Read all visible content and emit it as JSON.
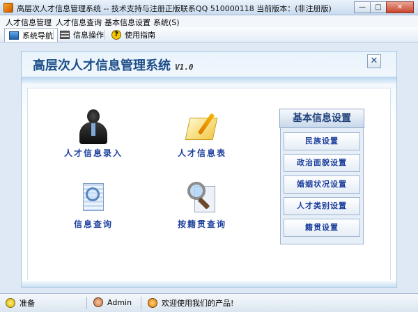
{
  "window": {
    "title": "高层次人才信息管理系统 -- 技术支持与注册正版联系QQ 510000118    当前版本：(非注册版)",
    "min_label": "—",
    "max_label": "□",
    "close_label": "✕"
  },
  "menu": [
    "人才信息管理",
    "人才信息查询",
    "基本信息设置",
    "系统(S)"
  ],
  "toolbar": {
    "nav_label": "系统导航",
    "info_label": "信息操作",
    "help_label": "使用指南",
    "help_glyph": "?"
  },
  "panel": {
    "title": "高层次人才信息管理系统",
    "version": "V1.0",
    "close_glyph": "✕"
  },
  "modules": {
    "entry": "人才信息录入",
    "table": "人才信息表",
    "query": "信息查询",
    "native_query": "按籍贯查询"
  },
  "settings": {
    "title": "基本信息设置",
    "items": [
      "民族设置",
      "政治面貌设置",
      "婚姻状况设置",
      "人才类别设置",
      "籍贯设置"
    ]
  },
  "status": {
    "ready": "准备",
    "user": "Admin",
    "message": "欢迎使用我们的产品!"
  }
}
